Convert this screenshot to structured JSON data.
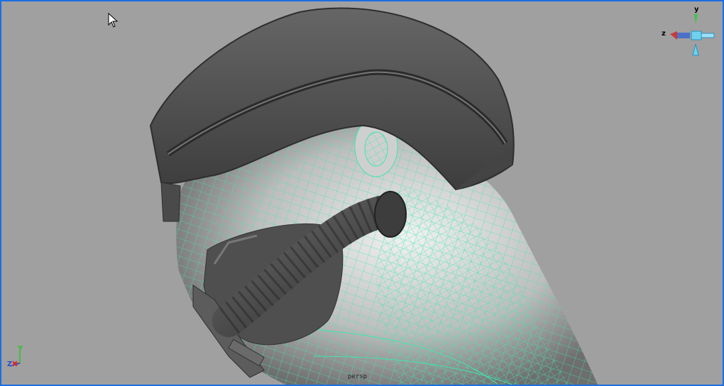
{
  "viewport": {
    "panel_name": "persp",
    "border_color": "#1a6fe0",
    "background_color": "#a0a0a0",
    "wire_color": "#3ee6b0",
    "mesh_color": "#d9d9d9",
    "helmet_color": "#5a5a5a"
  },
  "viewcube": {
    "y_label": "y",
    "z_label": "z"
  },
  "axis_gizmo": {
    "z_label": "Z",
    "x_label": "X",
    "y_label": "Y"
  },
  "hud": {
    "bottom_text": "persp"
  },
  "icons": {
    "cursor": "arrow-cursor-icon"
  }
}
